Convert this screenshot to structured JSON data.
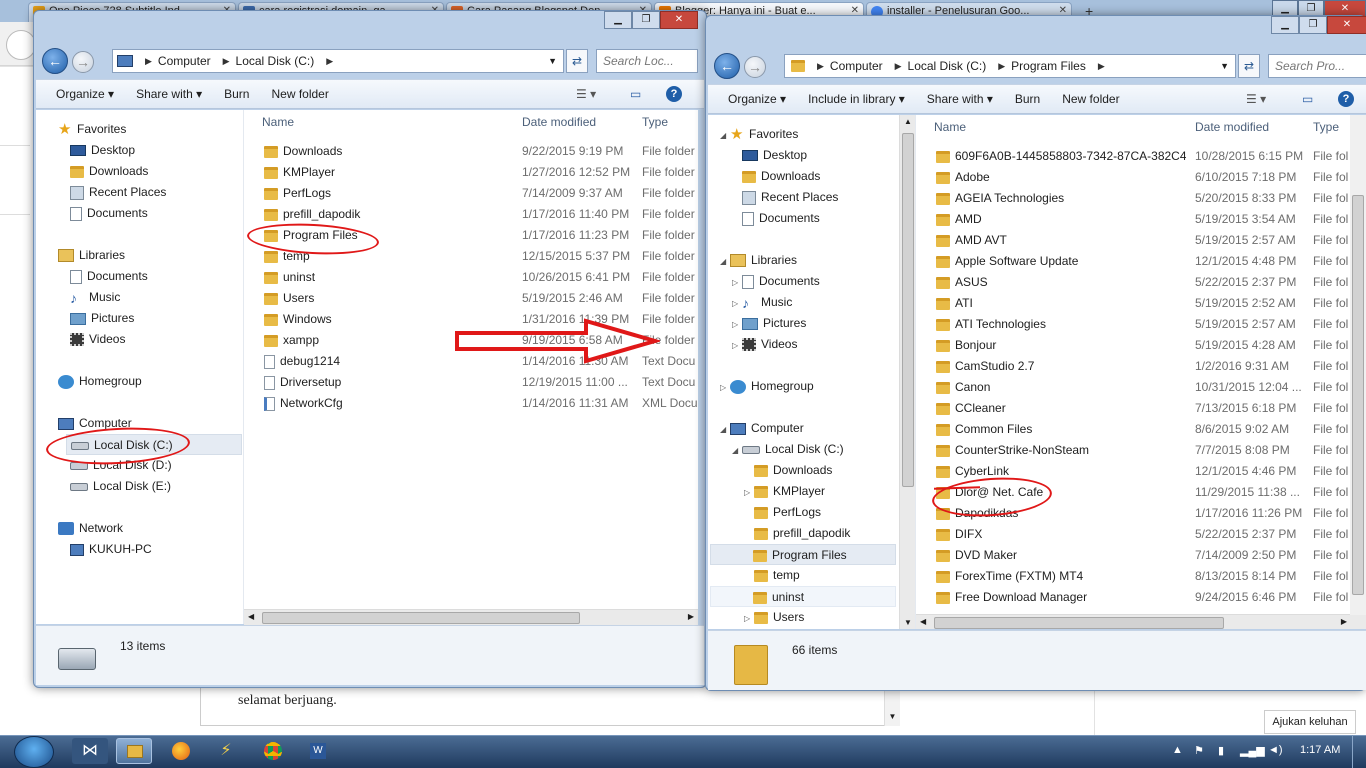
{
  "browser": {
    "tabs": [
      {
        "title": "One Piece 728 Subtitle Ind"
      },
      {
        "title": "cara registrasi domain .ga -"
      },
      {
        "title": "Cara Pasang Blogspot Den"
      },
      {
        "title": "Blogger: Hanya ini - Buat e..."
      },
      {
        "title": "installer - Penelusuran Goo..."
      }
    ],
    "new_tab": "+"
  },
  "page": {
    "editor_text": "selamat berjuang.",
    "help_button": "Ajukan keluhan"
  },
  "left_window": {
    "address": [
      "Computer",
      "Local Disk (C:)"
    ],
    "search_placeholder": "Search Loc...",
    "commands": [
      "Organize",
      "Share with",
      "Burn",
      "New folder"
    ],
    "nav": {
      "favorites": "Favorites",
      "fav_items": [
        "Desktop",
        "Downloads",
        "Recent Places",
        "Documents"
      ],
      "libraries": "Libraries",
      "lib_items": [
        "Documents",
        "Music",
        "Pictures",
        "Videos"
      ],
      "homegroup": "Homegroup",
      "computer": "Computer",
      "drives": [
        "Local Disk (C:)",
        "Local Disk (D:)",
        "Local Disk (E:)"
      ],
      "network": "Network",
      "network_items": [
        "KUKUH-PC"
      ]
    },
    "columns": [
      "Name",
      "Date modified",
      "Type"
    ],
    "files": [
      {
        "name": "Downloads",
        "date": "9/22/2015 9:19 PM",
        "type": "File folder",
        "icon": "folder-icon"
      },
      {
        "name": "KMPlayer",
        "date": "1/27/2016 12:52 PM",
        "type": "File folder",
        "icon": "folder-icon"
      },
      {
        "name": "PerfLogs",
        "date": "7/14/2009 9:37 AM",
        "type": "File folder",
        "icon": "folder-icon"
      },
      {
        "name": "prefill_dapodik",
        "date": "1/17/2016 11:40 PM",
        "type": "File folder",
        "icon": "folder-icon"
      },
      {
        "name": "Program Files",
        "date": "1/17/2016 11:23 PM",
        "type": "File folder",
        "icon": "folder-icon"
      },
      {
        "name": "temp",
        "date": "12/15/2015 5:37 PM",
        "type": "File folder",
        "icon": "folder-icon"
      },
      {
        "name": "uninst",
        "date": "10/26/2015 6:41 PM",
        "type": "File folder",
        "icon": "folder-icon"
      },
      {
        "name": "Users",
        "date": "5/19/2015 2:46 AM",
        "type": "File folder",
        "icon": "folder-icon"
      },
      {
        "name": "Windows",
        "date": "1/31/2016 11:39 PM",
        "type": "File folder",
        "icon": "folder-icon"
      },
      {
        "name": "xampp",
        "date": "9/19/2015 6:58 AM",
        "type": "File folder",
        "icon": "folder-icon"
      },
      {
        "name": "debug1214",
        "date": "1/14/2016 11:30 AM",
        "type": "Text Docu",
        "icon": "text-file-icon"
      },
      {
        "name": "Driversetup",
        "date": "12/19/2015 11:00 ...",
        "type": "Text Docu",
        "icon": "text-file-icon"
      },
      {
        "name": "NetworkCfg",
        "date": "1/14/2016 11:31 AM",
        "type": "XML Docu",
        "icon": "xml-file-icon"
      }
    ],
    "status": "13 items"
  },
  "right_window": {
    "address": [
      "Computer",
      "Local Disk (C:)",
      "Program Files"
    ],
    "search_placeholder": "Search Pro...",
    "commands": [
      "Organize",
      "Include in library",
      "Share with",
      "Burn",
      "New folder"
    ],
    "nav": {
      "favorites": "Favorites",
      "fav_items": [
        "Desktop",
        "Downloads",
        "Recent Places",
        "Documents"
      ],
      "libraries": "Libraries",
      "lib_items": [
        "Documents",
        "Music",
        "Pictures",
        "Videos"
      ],
      "homegroup": "Homegroup",
      "computer": "Computer",
      "drive": "Local Disk (C:)",
      "drive_items": [
        "Downloads",
        "KMPlayer",
        "PerfLogs",
        "prefill_dapodik",
        "Program Files",
        "temp",
        "uninst",
        "Users"
      ]
    },
    "columns": [
      "Name",
      "Date modified",
      "Type"
    ],
    "files": [
      {
        "name": "609F6A0B-1445858803-7342-87CA-382C4...",
        "date": "10/28/2015 6:15 PM",
        "type": "File fol"
      },
      {
        "name": "Adobe",
        "date": "6/10/2015 7:18 PM",
        "type": "File fol"
      },
      {
        "name": "AGEIA Technologies",
        "date": "5/20/2015 8:33 PM",
        "type": "File fol"
      },
      {
        "name": "AMD",
        "date": "5/19/2015 3:54 AM",
        "type": "File fol"
      },
      {
        "name": "AMD AVT",
        "date": "5/19/2015 2:57 AM",
        "type": "File fol"
      },
      {
        "name": "Apple Software Update",
        "date": "12/1/2015 4:48 PM",
        "type": "File fol"
      },
      {
        "name": "ASUS",
        "date": "5/22/2015 2:37 PM",
        "type": "File fol"
      },
      {
        "name": "ATI",
        "date": "5/19/2015 2:52 AM",
        "type": "File fol"
      },
      {
        "name": "ATI Technologies",
        "date": "5/19/2015 2:57 AM",
        "type": "File fol"
      },
      {
        "name": "Bonjour",
        "date": "5/19/2015 4:28 AM",
        "type": "File fol"
      },
      {
        "name": "CamStudio 2.7",
        "date": "1/2/2016 9:31 AM",
        "type": "File fol"
      },
      {
        "name": "Canon",
        "date": "10/31/2015 12:04 ...",
        "type": "File fol"
      },
      {
        "name": "CCleaner",
        "date": "7/13/2015 6:18 PM",
        "type": "File fol"
      },
      {
        "name": "Common Files",
        "date": "8/6/2015 9:02 AM",
        "type": "File fol"
      },
      {
        "name": "CounterStrike-NonSteam",
        "date": "7/7/2015 8:08 PM",
        "type": "File fol"
      },
      {
        "name": "CyberLink",
        "date": "12/1/2015 4:46 PM",
        "type": "File fol"
      },
      {
        "name": "Dlor@ Net. Cafe",
        "date": "11/29/2015 11:38 ...",
        "type": "File fol"
      },
      {
        "name": "Dapodikdas",
        "date": "1/17/2016 11:26 PM",
        "type": "File fol"
      },
      {
        "name": "DIFX",
        "date": "5/22/2015 2:37 PM",
        "type": "File fol"
      },
      {
        "name": "DVD Maker",
        "date": "7/14/2009 2:50 PM",
        "type": "File fol"
      },
      {
        "name": "ForexTime (FXTM) MT4",
        "date": "8/13/2015 8:14 PM",
        "type": "File fol"
      },
      {
        "name": "Free Download Manager",
        "date": "9/24/2015 6:46 PM",
        "type": "File fol"
      }
    ],
    "status": "66 items"
  },
  "taskbar": {
    "clock": "1:17 AM"
  },
  "colors": {
    "annotation": "#e01818",
    "accent": "#1f5ea8",
    "folder": "#e8bb46"
  }
}
